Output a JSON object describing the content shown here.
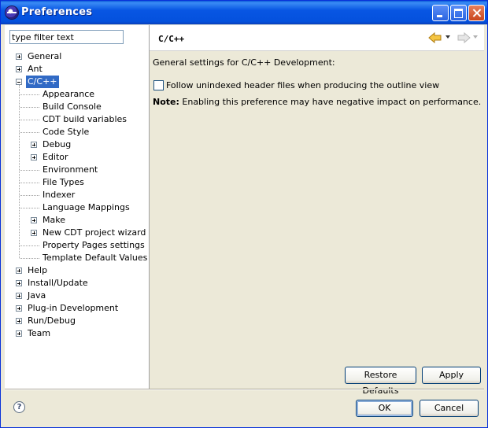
{
  "window": {
    "title": "Preferences"
  },
  "filter": {
    "value": "type filter text"
  },
  "tree": [
    {
      "label": "General",
      "expander": "plus",
      "depth": 0
    },
    {
      "label": "Ant",
      "expander": "plus",
      "depth": 0
    },
    {
      "label": "C/C++",
      "expander": "minus",
      "depth": 0,
      "selected": true
    },
    {
      "label": "Appearance",
      "expander": "none",
      "depth": 1
    },
    {
      "label": "Build Console",
      "expander": "none",
      "depth": 1
    },
    {
      "label": "CDT build variables",
      "expander": "none",
      "depth": 1
    },
    {
      "label": "Code Style",
      "expander": "none",
      "depth": 1
    },
    {
      "label": "Debug",
      "expander": "plus",
      "depth": 1
    },
    {
      "label": "Editor",
      "expander": "plus",
      "depth": 1
    },
    {
      "label": "Environment",
      "expander": "none",
      "depth": 1
    },
    {
      "label": "File Types",
      "expander": "none",
      "depth": 1
    },
    {
      "label": "Indexer",
      "expander": "none",
      "depth": 1
    },
    {
      "label": "Language Mappings",
      "expander": "none",
      "depth": 1
    },
    {
      "label": "Make",
      "expander": "plus",
      "depth": 1
    },
    {
      "label": "New CDT project wizard",
      "expander": "plus",
      "depth": 1
    },
    {
      "label": "Property Pages settings",
      "expander": "none",
      "depth": 1
    },
    {
      "label": "Template Default Values",
      "expander": "none",
      "depth": 1
    },
    {
      "label": "Help",
      "expander": "plus",
      "depth": 0
    },
    {
      "label": "Install/Update",
      "expander": "plus",
      "depth": 0
    },
    {
      "label": "Java",
      "expander": "plus",
      "depth": 0
    },
    {
      "label": "Plug-in Development",
      "expander": "plus",
      "depth": 0
    },
    {
      "label": "Run/Debug",
      "expander": "plus",
      "depth": 0
    },
    {
      "label": "Team",
      "expander": "plus",
      "depth": 0
    }
  ],
  "page": {
    "title": "C/C++",
    "description": "General settings for C/C++ Development:",
    "checkbox": {
      "label": "Follow unindexed header files when producing the outline view",
      "checked": false
    },
    "note": {
      "prefix": "Note:",
      "text": "Enabling this preference may have negative impact on performance."
    }
  },
  "buttons": {
    "restore_defaults": "Restore Defaults",
    "apply": "Apply",
    "ok": "OK",
    "cancel": "Cancel"
  },
  "icons": {
    "app": "eclipse-icon",
    "back": "back-arrow-icon",
    "forward": "forward-arrow-icon",
    "help": "help-icon"
  },
  "colors": {
    "titlebar": "#0a59d8",
    "selection": "#316ac5",
    "dialog_bg": "#ece9d8",
    "back_arrow": "#f0b020"
  }
}
